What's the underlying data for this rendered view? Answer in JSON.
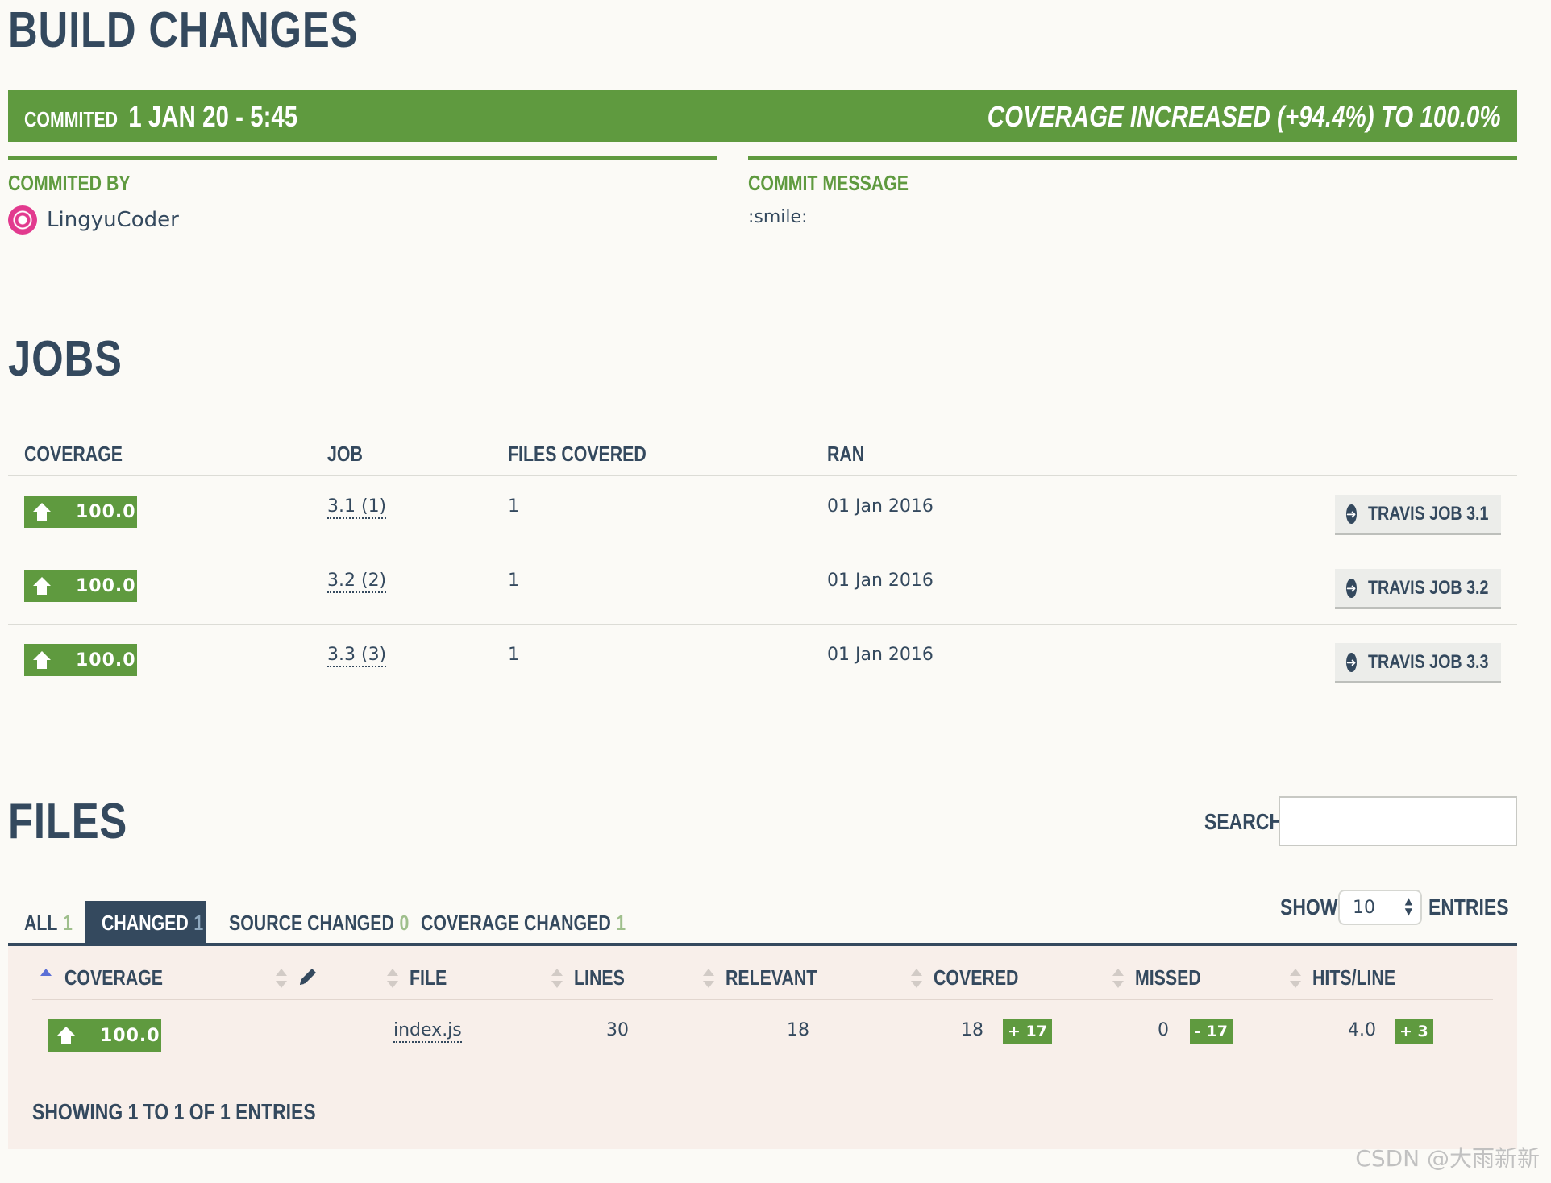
{
  "page": {
    "build_title": "BUILD CHANGES",
    "jobs_title": "JOBS",
    "files_title": "FILES"
  },
  "banner": {
    "committed_label": "COMMITED",
    "committed_value": "1 JAN 20 - 5:45",
    "coverage_text": "COVERAGE INCREASED (+94.4%) TO 100.0%",
    "color": "#5f9a3f"
  },
  "commit": {
    "by_label": "COMMITED BY",
    "author": "LingyuCoder",
    "message_label": "COMMIT MESSAGE",
    "message": ":smile:"
  },
  "jobs": {
    "headers": [
      "COVERAGE",
      "JOB",
      "FILES COVERED",
      "RAN"
    ],
    "rows": [
      {
        "coverage": "100.0",
        "job": "3.1 (1)",
        "files_covered": "1",
        "ran": "01 Jan 2016",
        "button": "TRAVIS JOB 3.1"
      },
      {
        "coverage": "100.0",
        "job": "3.2 (2)",
        "files_covered": "1",
        "ran": "01 Jan 2016",
        "button": "TRAVIS JOB 3.2"
      },
      {
        "coverage": "100.0",
        "job": "3.3 (3)",
        "files_covered": "1",
        "ran": "01 Jan 2016",
        "button": "TRAVIS JOB 3.3"
      }
    ]
  },
  "files": {
    "search_label": "SEARCH:",
    "search_value": "",
    "tabs": [
      {
        "label": "ALL",
        "count": "1"
      },
      {
        "label": "CHANGED",
        "count": "1"
      },
      {
        "label": "SOURCE CHANGED",
        "count": "0"
      },
      {
        "label": "COVERAGE CHANGED",
        "count": "1"
      }
    ],
    "show_label": "SHOW",
    "entries_value": "10",
    "entries_label": "ENTRIES",
    "headers": [
      "COVERAGE",
      "FILE",
      "LINES",
      "RELEVANT",
      "COVERED",
      "MISSED",
      "HITS/LINE"
    ],
    "rows": [
      {
        "coverage": "100.0",
        "file": "index.js",
        "lines": "30",
        "relevant": "18",
        "covered": "18",
        "covered_delta": "+ 17",
        "missed": "0",
        "missed_delta": "- 17",
        "hits": "4.0",
        "hits_delta": "+ 3"
      }
    ],
    "showing": "SHOWING 1 TO 1 OF 1 ENTRIES"
  },
  "watermark": "CSDN @大雨新新"
}
